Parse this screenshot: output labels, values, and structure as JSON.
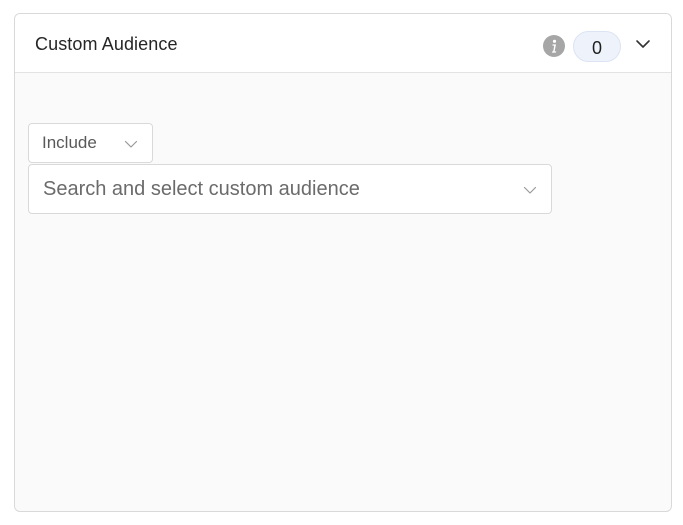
{
  "panel": {
    "title": "Custom Audience",
    "count": "0",
    "info_icon": "info-icon",
    "toggle_icon": "chevron-down-icon"
  },
  "filter": {
    "mode_value": "Include",
    "mode_icon": "chevron-down-icon"
  },
  "audience_search": {
    "value": "",
    "placeholder": "Search and select custom audience",
    "icon": "chevron-down-icon"
  },
  "colors": {
    "panel_border": "#d9d9d9",
    "panel_body": "#fafafa",
    "badge_bg": "#eef3fb",
    "info_icon": "#a6a6a6"
  }
}
